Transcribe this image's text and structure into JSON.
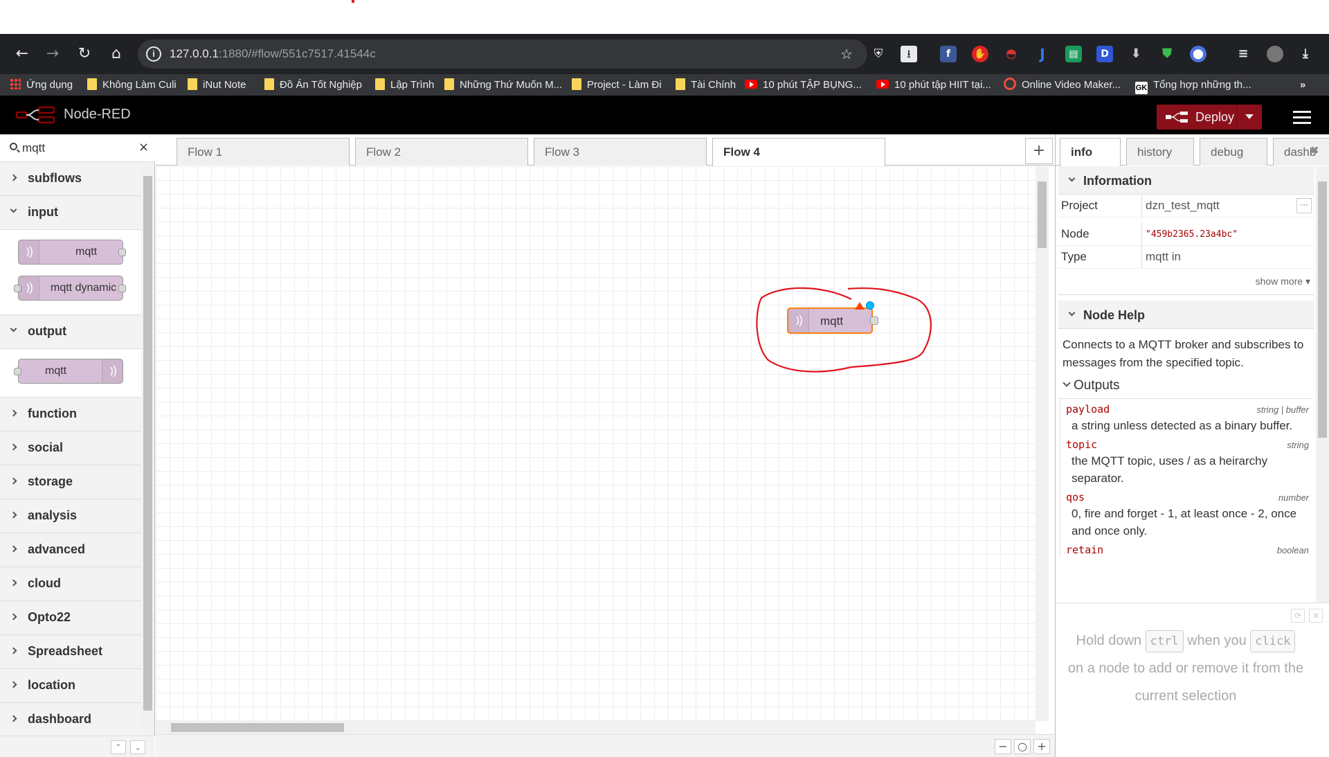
{
  "browser": {
    "url_host": "127.0.0.1",
    "url_rest": ":1880/#flow/551c7517.41544c",
    "bookmarks": [
      "Ứng dụng",
      "Không Làm Culi",
      "iNut Note",
      "Đồ Án Tốt Nghiệp",
      "Lập Trình",
      "Những Thứ Muốn M...",
      "Project - Làm Đi",
      "Tài Chính",
      "10 phút TẬP BỤNG...",
      "10 phút tập HIIT tại...",
      "Online Video Maker...",
      "Tổng hợp những th..."
    ],
    "bookmarks_more": "»"
  },
  "header": {
    "title": "Node-RED",
    "deploy_label": "Deploy"
  },
  "palette": {
    "search_value": "mqtt",
    "categories": [
      "subflows",
      "input",
      "output",
      "function",
      "social",
      "storage",
      "analysis",
      "advanced",
      "cloud",
      "Opto22",
      "Spreadsheet",
      "location",
      "dashboard"
    ],
    "input_nodes": [
      "mqtt",
      "mqtt dynamic"
    ],
    "output_nodes": [
      "mqtt"
    ]
  },
  "workspace": {
    "tabs": [
      "Flow 1",
      "Flow 2",
      "Flow 3",
      "Flow 4"
    ],
    "active_tab": "Flow 4",
    "node_label": "mqtt"
  },
  "sidebar": {
    "tabs": [
      "info",
      "history",
      "debug",
      "dashb"
    ],
    "information_title": "Information",
    "project_key": "Project",
    "project_value": "dzn_test_mqtt",
    "node_key": "Node",
    "node_value": "\"459b2365.23a4bc\"",
    "type_key": "Type",
    "type_value": "mqtt in",
    "show_more": "show more ▾",
    "help_title": "Node Help",
    "help_text": "Connects to a MQTT broker and subscribes to messages from the specified topic.",
    "outputs_title": "Outputs",
    "outputs": [
      {
        "name": "payload",
        "type": "string | buffer",
        "desc": "a string unless detected as a binary buffer."
      },
      {
        "name": "topic",
        "type": "string",
        "desc": "the MQTT topic, uses / as a heirarchy separator."
      },
      {
        "name": "qos",
        "type": "number",
        "desc": "0, fire and forget - 1, at least once - 2, once and once only."
      },
      {
        "name": "retain",
        "type": "boolean",
        "desc": ""
      }
    ],
    "tip": {
      "part1": "Hold down",
      "key1": "ctrl",
      "part2": "when you",
      "key2": "click",
      "part3": "on a node to add or remove it from the current selection"
    }
  },
  "colors": {
    "deploy": "#8c101c",
    "node_fill": "#d8bfd8",
    "selection": "#ff7f0e",
    "annotation": "#e0141e"
  }
}
